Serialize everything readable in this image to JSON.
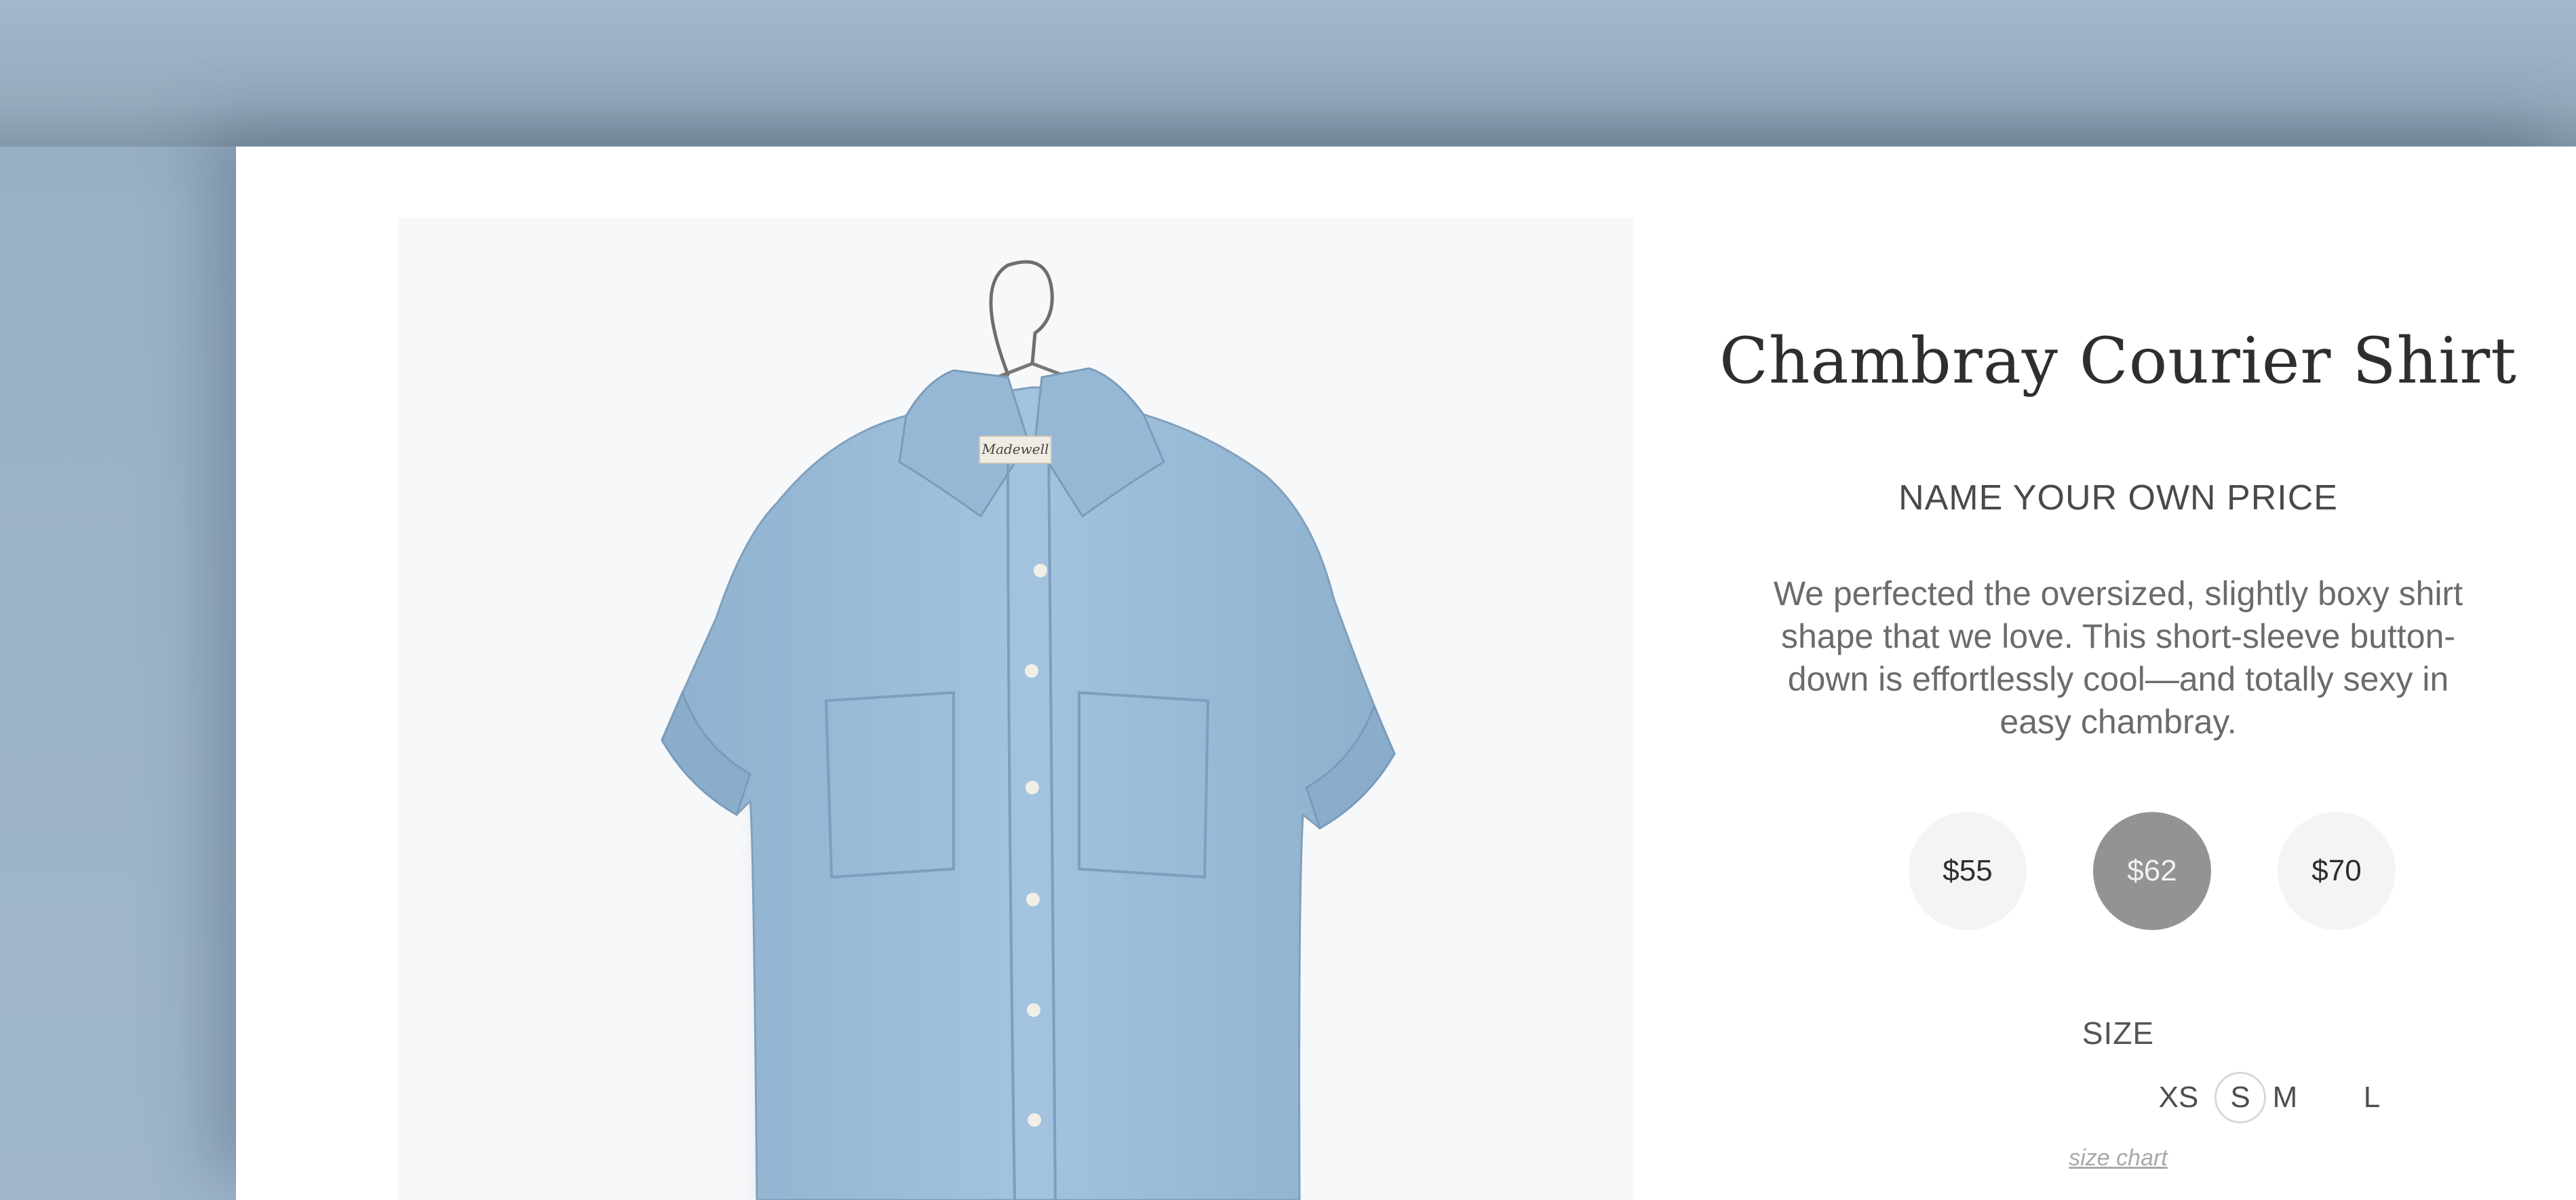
{
  "product": {
    "title": "Chambray Courier Shirt",
    "subtitle": "NAME YOUR OWN PRICE",
    "description": "We perfected the oversized, slightly boxy shirt shape that we love. This short-sleeve button-down is effortlessly cool—and totally sexy in easy chambray.",
    "tag_text": "Madewell",
    "image": {
      "label": "Chambray short-sleeve shirt on hanger",
      "shirt_color": "#9fc0dc",
      "background_color": "#f7f8fa"
    }
  },
  "prices": {
    "options": [
      "$55",
      "$62",
      "$70"
    ],
    "selected": "$62"
  },
  "size": {
    "label": "SIZE",
    "options": [
      "XS",
      "S",
      "M",
      "L"
    ],
    "selected": "S",
    "chart_link": "size chart"
  },
  "colors": {
    "page_background": "#9ab2c8",
    "card_background": "#ffffff",
    "selected_price_bg": "#939393",
    "unselected_price_bg": "#f4f4f5"
  }
}
